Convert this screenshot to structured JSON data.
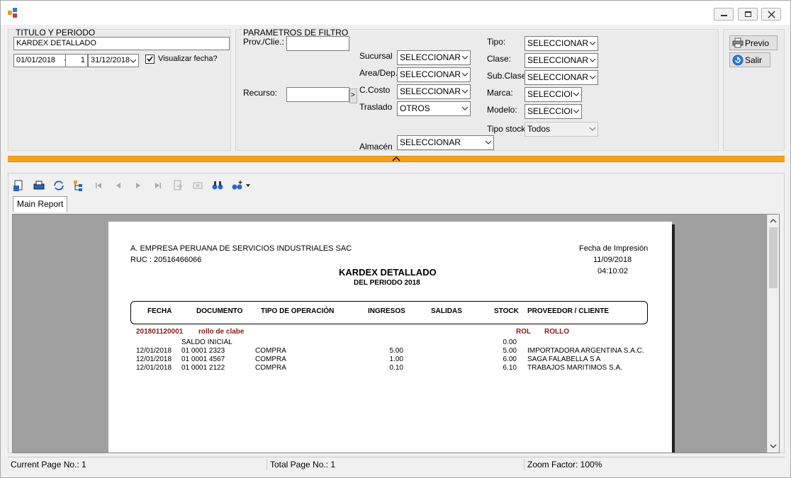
{
  "window": {
    "title": ""
  },
  "titulo_group": {
    "title": "TITULO Y PERIODO",
    "report_title": "KARDEX DETALLADO",
    "date_from": "01/01/2018",
    "period_num": "1",
    "date_to": "31/12/2018",
    "visualizar_label": "Visualizar fecha?",
    "visualizar_checked": true
  },
  "filtro_group": {
    "title": "PARAMETROS DE FILTRO",
    "prov_label": "Prov./Clie.:",
    "prov_value": "",
    "recurso_label": "Recurso:",
    "recurso_value": "",
    "recurso_btn": ">",
    "sucursal_label": "Sucursal",
    "sucursal_value": "SELECCIONAR",
    "area_label": "Area/Dep.",
    "area_value": "SELECCIONAR",
    "ccosto_label": "C.Costo",
    "ccosto_value": "SELECCIONAR",
    "traslado_label": "Traslado",
    "traslado_value": "OTROS",
    "almacen_label": "Almacén",
    "almacen_value": "SELECCIONAR",
    "tipo_label": "Tipo:",
    "tipo_value": "SELECCIONAR",
    "clase_label": "Clase:",
    "clase_value": "SELECCIONAR",
    "subclase_label": "Sub.Clase",
    "subclase_value": "SELECCIONAR",
    "marca_label": "Marca:",
    "marca_value": "SELECCIOI",
    "modelo_label": "Modelo:",
    "modelo_value": "SELECCIOI",
    "tipostock_label": "Tipo stock",
    "tipostock_value": "Todos"
  },
  "actions": {
    "previo": "Previo",
    "salir": "Salir"
  },
  "viewer": {
    "tab": "Main Report",
    "toolbar_icons": [
      "export-icon",
      "print-icon",
      "refresh-icon",
      "group-tree-icon",
      "first-page-icon",
      "prev-page-icon",
      "next-page-icon",
      "last-page-icon",
      "goto-page-icon",
      "close-view-icon",
      "find-icon",
      "zoom-icon"
    ]
  },
  "report": {
    "company": "A. EMPRESA PERUANA DE SERVICIOS INDUSTRIALES SAC",
    "ruc": "RUC : 20516466066",
    "title": "KARDEX DETALLADO",
    "subtitle": "DEL PERIODO 2018",
    "fecha_impresion_label": "Fecha de Impresión",
    "fecha_impresion": "11/09/2018",
    "hora_impresion": "04:10:02",
    "columns": {
      "fecha": "FECHA",
      "documento": "DOCUMENTO",
      "tipo": "TIPO DE OPERACIÓN",
      "ingresos": "INGRESOS",
      "salidas": "SALIDAS",
      "stock": "STOCK",
      "proveedor": "PROVEEDOR / CLIENTE"
    },
    "group": {
      "code": "201801120001",
      "name": "rollo de clabe",
      "unit": "ROL",
      "unit_name": "ROLLO"
    },
    "saldo": {
      "label": "SALDO INICIAL",
      "stock": "0.00"
    },
    "rows": [
      {
        "fecha": "12/01/2018",
        "documento": "01 0001 2323",
        "tipo": "COMPRA",
        "ingresos": "5.00",
        "stock": "5.00",
        "proveedor": "IMPORTADORA ARGENTINA S.A.C."
      },
      {
        "fecha": "12/01/2018",
        "documento": "01 0001 4567",
        "tipo": "COMPRA",
        "ingresos": "1.00",
        "stock": "6.00",
        "proveedor": "SAGA FALABELLA S A"
      },
      {
        "fecha": "12/01/2018",
        "documento": "01 0001 2122",
        "tipo": "COMPRA",
        "ingresos": "0.10",
        "stock": "6.10",
        "proveedor": "TRABAJOS MARITIMOS S.A."
      }
    ]
  },
  "status": {
    "current_page": "Current Page No.: 1",
    "total_page": "Total Page No.: 1",
    "zoom": "Zoom Factor: 100%"
  }
}
